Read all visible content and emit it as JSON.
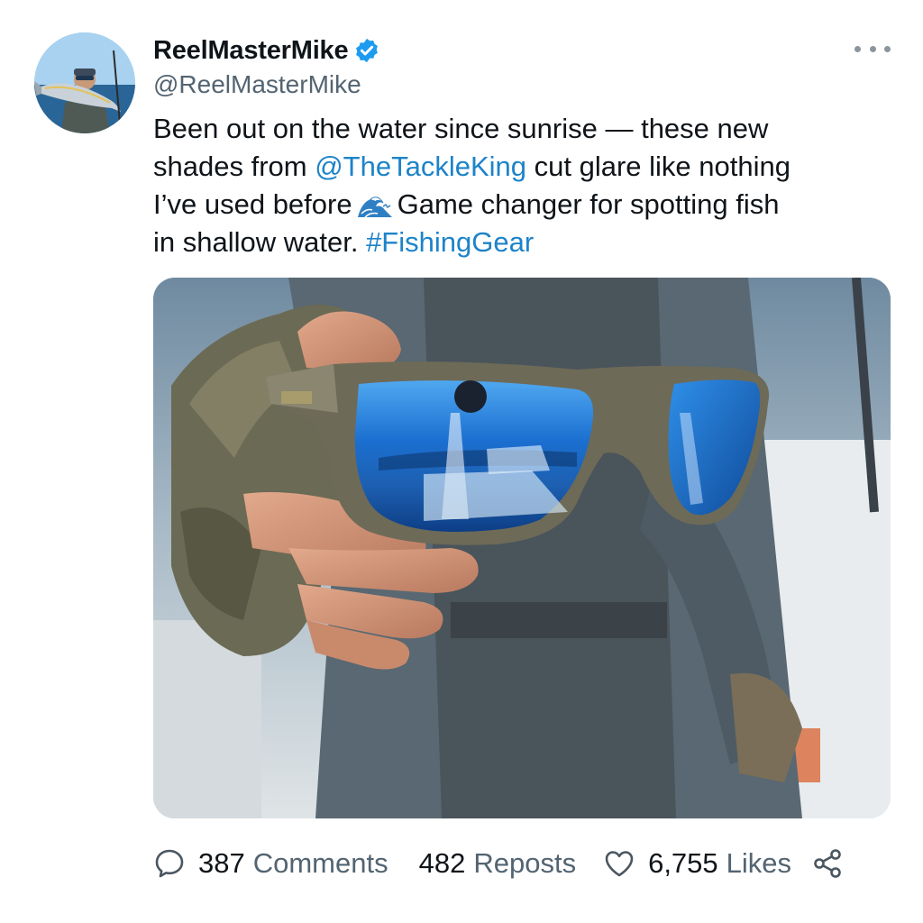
{
  "post": {
    "author": {
      "display_name": "ReelMasterMike",
      "handle": "@ReelMasterMike",
      "verified": true,
      "verified_icon": "verified-badge-icon"
    },
    "text": {
      "line1": "Been out on the water since sunrise — these new",
      "line2_before": "shades from ",
      "mention": "@TheTackleKing",
      "line2_after": " cut glare like nothing",
      "line3_before": "I’ve used before",
      "emoji": "wave-emoji",
      "line3_after": "Game changer for spotting fish",
      "line4_before": "in shallow water. ",
      "hashtag": "#FishingGear"
    },
    "media": {
      "description_icon": "photo-sunglasses-on-boat"
    },
    "stats": {
      "comments_count": "387",
      "comments_label": "Comments",
      "reposts_count": "482",
      "reposts_label": "Reposts",
      "likes_count": "6,755",
      "likes_label": "Likes"
    }
  },
  "colors": {
    "link": "#1d83c9",
    "secondary_text": "#536471",
    "verified": "#1d9bf0",
    "icon": "#4a5660"
  }
}
